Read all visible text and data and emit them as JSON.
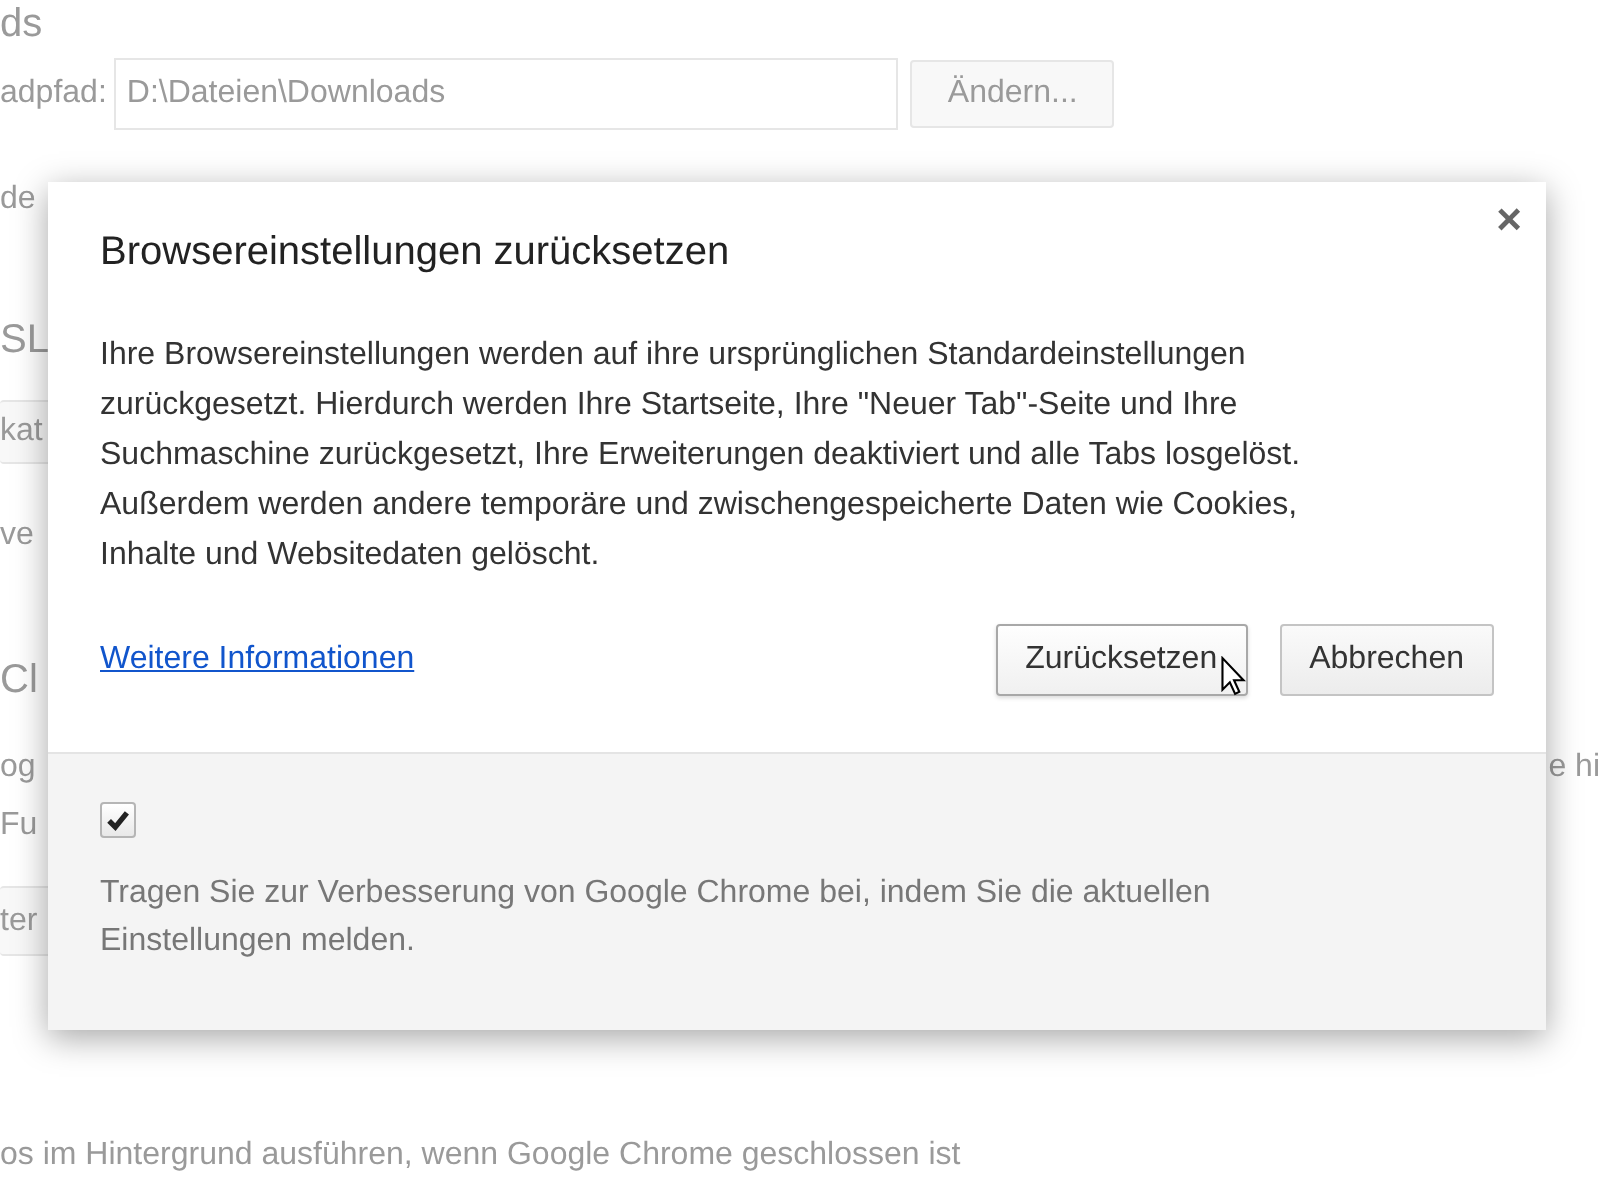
{
  "background": {
    "heading_1": "ds",
    "download_path": {
      "label": "adpfad:",
      "value": "D:\\Dateien\\Downloads",
      "button": "Ändern..."
    },
    "text_1": "de",
    "heading_2": "SL",
    "button_1": "kat",
    "text_2": "ve",
    "heading_3": "Cl",
    "text_3": "og",
    "text_4": "e hi",
    "text_5": "Fu",
    "button_2": "ter",
    "text_6": "os im Hintergrund ausführen, wenn Google Chrome geschlossen ist"
  },
  "dialog": {
    "title": "Browsereinstellungen zurücksetzen",
    "close": "×",
    "body": "Ihre Browsereinstellungen werden auf ihre ursprünglichen Standardeinstellungen zurückgesetzt. Hierdurch werden Ihre Startseite, Ihre \"Neuer Tab\"-Seite und Ihre Suchmaschine zurückgesetzt, Ihre Erweiterungen deaktiviert und alle Tabs losgelöst. Außerdem werden andere temporäre und zwischengespeicherte Daten wie Cookies, Inhalte und Websitedaten gelöscht.",
    "link": "Weitere Informationen",
    "buttons": [
      {
        "label": "Zurücksetzen",
        "hovered": true
      },
      {
        "label": "Abbrechen",
        "hovered": false
      }
    ],
    "checkbox": {
      "checked": true
    },
    "footer_text": "Tragen Sie zur Verbesserung von Google Chrome bei, indem Sie die aktuellen Einstellungen melden."
  }
}
